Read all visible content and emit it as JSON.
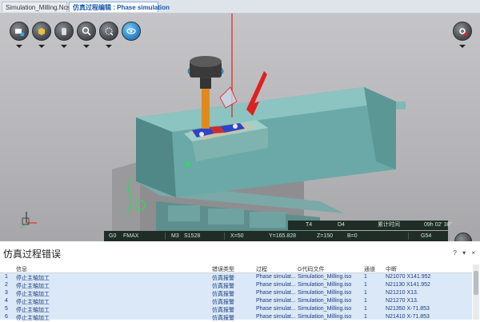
{
  "tabs": [
    {
      "label": "Simulation_Milling.NcsPrj"
    },
    {
      "label": "仿真过程编辑 : Phase simulation"
    }
  ],
  "toolbar": {
    "icons": [
      "view-icon",
      "cube-icon",
      "cylinder-icon",
      "zoom-icon",
      "target-icon",
      "rotate-icon",
      "gear-icon"
    ]
  },
  "status": {
    "t": "T4",
    "d": "D4",
    "accum_label": "累计时间",
    "time": "09h 02' 38\"",
    "g0": "G0",
    "feed": "FMAX",
    "m": "M3",
    "s": "S1528",
    "x": "X=50",
    "y": "Y=165.828",
    "z": "Z=150",
    "b": "B=0",
    "g54": "G54"
  },
  "panel": {
    "title": "仿真过程错误",
    "controls": [
      "?",
      "▾",
      "×"
    ],
    "columns": [
      "信息",
      "错误类型",
      "过程",
      "G代码文件",
      "通道",
      "中断"
    ],
    "rows": [
      {
        "no": "1",
        "info": "停止主轴加工",
        "type": "仿真报警",
        "process": "Phase simulat...",
        "file": "Simulation_Milling.iso",
        "channel": "1",
        "interrupt": "N21070 X141.952"
      },
      {
        "no": "2",
        "info": "停止主轴加工",
        "type": "仿真报警",
        "process": "Phase simulat...",
        "file": "Simulation_Milling.iso",
        "channel": "1",
        "interrupt": "N21130 X141.952"
      },
      {
        "no": "3",
        "info": "停止主轴加工",
        "type": "仿真报警",
        "process": "Phase simulat...",
        "file": "Simulation_Milling.iso",
        "channel": "1",
        "interrupt": "N21210 X13."
      },
      {
        "no": "4",
        "info": "停止主轴加工",
        "type": "仿真报警",
        "process": "Phase simulat...",
        "file": "Simulation_Milling.iso",
        "channel": "1",
        "interrupt": "N21270 X13."
      },
      {
        "no": "5",
        "info": "停止主轴加工",
        "type": "仿真报警",
        "process": "Phase simulat...",
        "file": "Simulation_Milling.iso",
        "channel": "1",
        "interrupt": "N21350 X-71.853"
      },
      {
        "no": "6",
        "info": "停止主轴加工",
        "type": "仿真报警",
        "process": "Phase simulat...",
        "file": "Simulation_Milling.iso",
        "channel": "1",
        "interrupt": "N21410 X-71.853"
      }
    ]
  },
  "colors": {
    "machine": "#6aa9a7",
    "tool_shank": "#e08a1e",
    "spindle_ring": "#3aa6e6",
    "alarm_arrow": "#e02020",
    "status_bg": "#1f2d26",
    "row_bg": "#dbe8f7"
  }
}
